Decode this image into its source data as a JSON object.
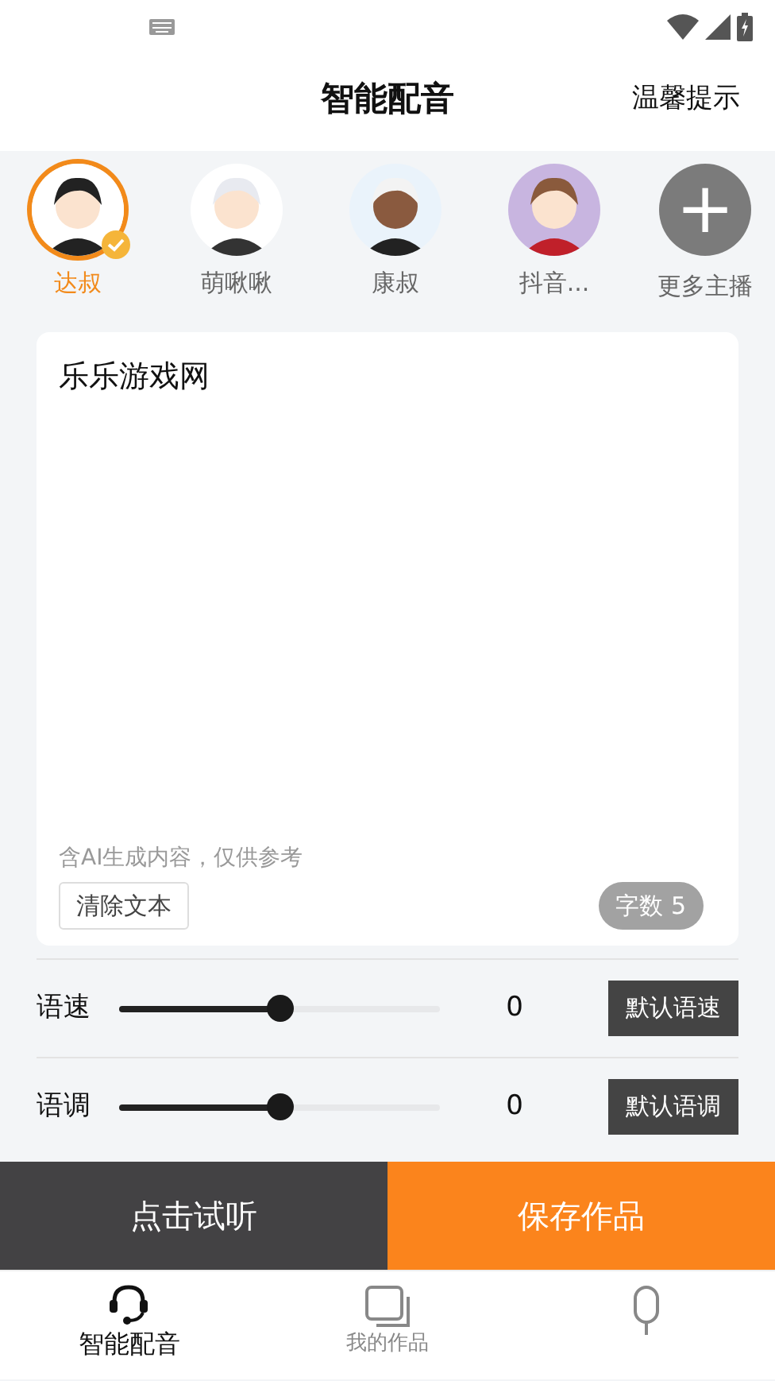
{
  "header": {
    "title": "智能配音",
    "action": "温馨提示"
  },
  "voices": [
    {
      "name": "达叔",
      "selected": true
    },
    {
      "name": "萌啾啾",
      "selected": false
    },
    {
      "name": "康叔",
      "selected": false
    },
    {
      "name": "抖音...",
      "selected": false
    }
  ],
  "more_voices": {
    "icon": "+",
    "label": "更多主播"
  },
  "editor": {
    "value": "乐乐游戏网",
    "note": "含AI生成内容，仅供参考",
    "clear": "清除文本",
    "count": "字数 5"
  },
  "sliders": [
    {
      "label": "语速",
      "level": 0.5,
      "reading": "0",
      "reset": "默认语速"
    },
    {
      "label": "语调",
      "level": 0.5,
      "reading": "0",
      "reset": "默认语调"
    }
  ],
  "actions": [
    {
      "label": "点击试听",
      "kind": "dark"
    },
    {
      "label": "保存作品",
      "kind": "accent"
    }
  ],
  "tabs": [
    {
      "label": "智能配音",
      "selected": true,
      "kind": "headset"
    },
    {
      "label": "我的作品",
      "selected": false,
      "kind": "works"
    },
    {
      "selected": false,
      "kind": "mic"
    }
  ]
}
